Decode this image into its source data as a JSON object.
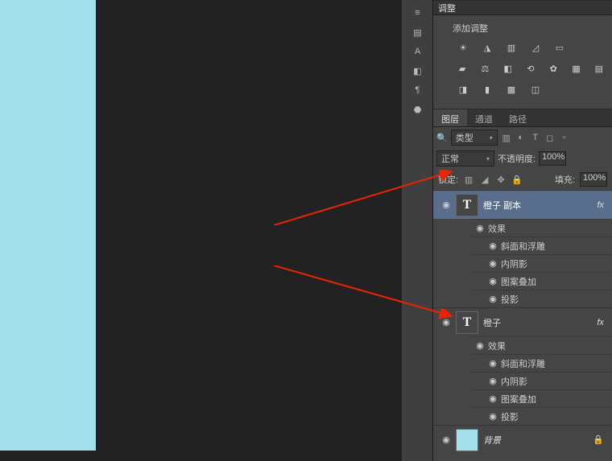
{
  "adjust": {
    "collapse_label": "调整",
    "title": "添加调整",
    "icons_row1": [
      "sun-icon",
      "mountain-icon",
      "histogram-icon",
      "diag-icon",
      "card-icon"
    ],
    "icons_row2": [
      "drop-icon",
      "balance-icon",
      "bw-icon",
      "swap-icon",
      "globe-icon",
      "grid-icon",
      "swatch-icon"
    ],
    "icons_row3": [
      "split-icon",
      "gradient-icon",
      "pattern-icon",
      "levels-icon"
    ]
  },
  "tabs": {
    "layers": "图层",
    "channels": "通道",
    "paths": "路径"
  },
  "filter": {
    "label": "类型"
  },
  "blend": {
    "mode": "正常",
    "opacity_label": "不透明度:",
    "opacity_value": "100%"
  },
  "lockrow": {
    "label": "锁定:",
    "fill_label": "填充:",
    "fill_value": "100%"
  },
  "layers": [
    {
      "name": "橙子 副本",
      "fx": "fx",
      "sel": true,
      "thumb": "T",
      "effects_label": "效果",
      "effects": [
        "斜面和浮雕",
        "内阴影",
        "图案叠加",
        "投影"
      ]
    },
    {
      "name": "橙子",
      "fx": "fx",
      "sel": false,
      "thumb": "T",
      "effects_label": "效果",
      "effects": [
        "斜面和浮雕",
        "内阴影",
        "图案叠加",
        "投影"
      ]
    },
    {
      "name": "背景",
      "fx": "",
      "sel": false,
      "thumb": "bg",
      "lock": true
    }
  ]
}
